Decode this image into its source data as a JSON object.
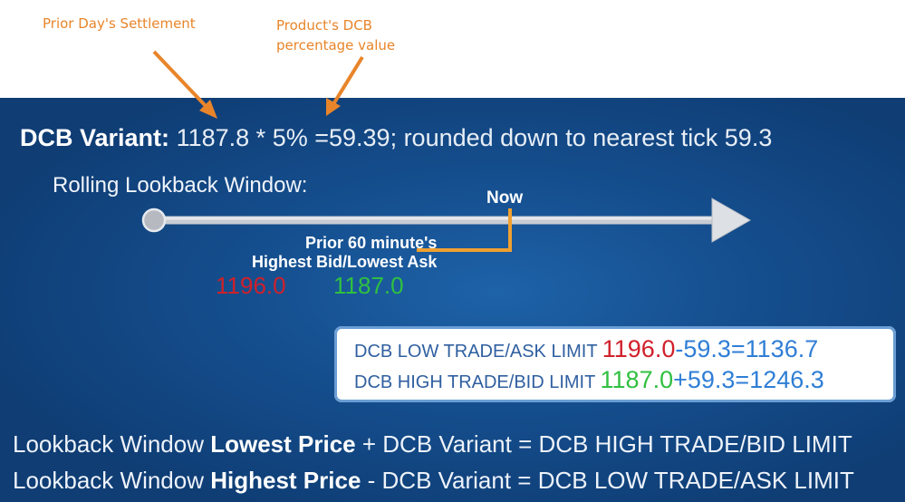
{
  "annotations": {
    "settlement": "Prior Day's Settlement",
    "dcb_pct_line1": "Product's DCB",
    "dcb_pct_line2": "percentage value"
  },
  "colors": {
    "annotation": "#e8852a",
    "slide_bg": "#154f8f",
    "red": "#d0202a",
    "green": "#30c040",
    "timeline_orange": "#f0a030"
  },
  "variant": {
    "label": "DCB Variant:",
    "settlement": "1187.8",
    "op": "*",
    "pct": "5%",
    "result": "=59.39; rounded down to nearest tick 59.3"
  },
  "timeline": {
    "title": "Rolling Lookback Window:",
    "now": "Now",
    "prior_line1": "Prior 60 minute's",
    "prior_line2": "Highest Bid/Lowest Ask",
    "highest_bid": "1196.0",
    "lowest_ask": "1187.0"
  },
  "limits": {
    "low_label": "DCB LOW TRADE/ASK LIMIT",
    "low_value": "1196.0",
    "low_calc": "-59.3=1136.7",
    "high_label": "DCB HIGH TRADE/BID LIMIT",
    "high_value": "1187.0",
    "high_calc": "+59.3=1246.3"
  },
  "formulas": {
    "line1_a": "Lookback Window ",
    "line1_b": "Lowest Price",
    "line1_c": " + DCB Variant = DCB HIGH TRADE/BID LIMIT",
    "line2_a": "Lookback Window ",
    "line2_b": "Highest Price",
    "line2_c": " - DCB Variant  = DCB LOW TRADE/ASK LIMIT"
  }
}
